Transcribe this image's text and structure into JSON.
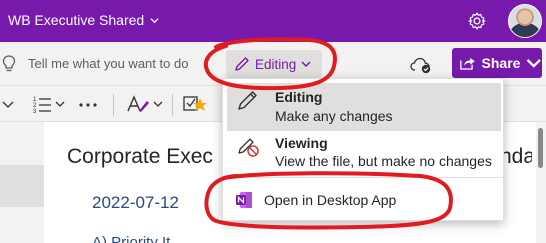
{
  "titlebar": {
    "notebook_name": "WB Executive Shared",
    "accent_color": "#7719aa",
    "settings_icon": "gear-icon",
    "avatar_icon": "user-avatar"
  },
  "command_bar": {
    "tell_me_placeholder": "Tell me what you want to do",
    "mode_button_label": "Editing",
    "share_label": "Share",
    "sync_icon": "cloud-sync-icon"
  },
  "mode_menu": {
    "items": [
      {
        "title": "Editing",
        "description": "Make any changes",
        "icon": "pencil-icon",
        "selected": true
      },
      {
        "title": "Viewing",
        "description": "View the file, but make no changes",
        "icon": "no-edit-icon",
        "selected": false
      }
    ],
    "open_desktop_label": "Open in Desktop App",
    "open_desktop_icon": "onenote-icon"
  },
  "page": {
    "title": "Corporate Exec",
    "title_tail": "nda",
    "date": "2022-07-12",
    "first_item": "A) Priority It"
  },
  "annotation_color": "#e11b22"
}
